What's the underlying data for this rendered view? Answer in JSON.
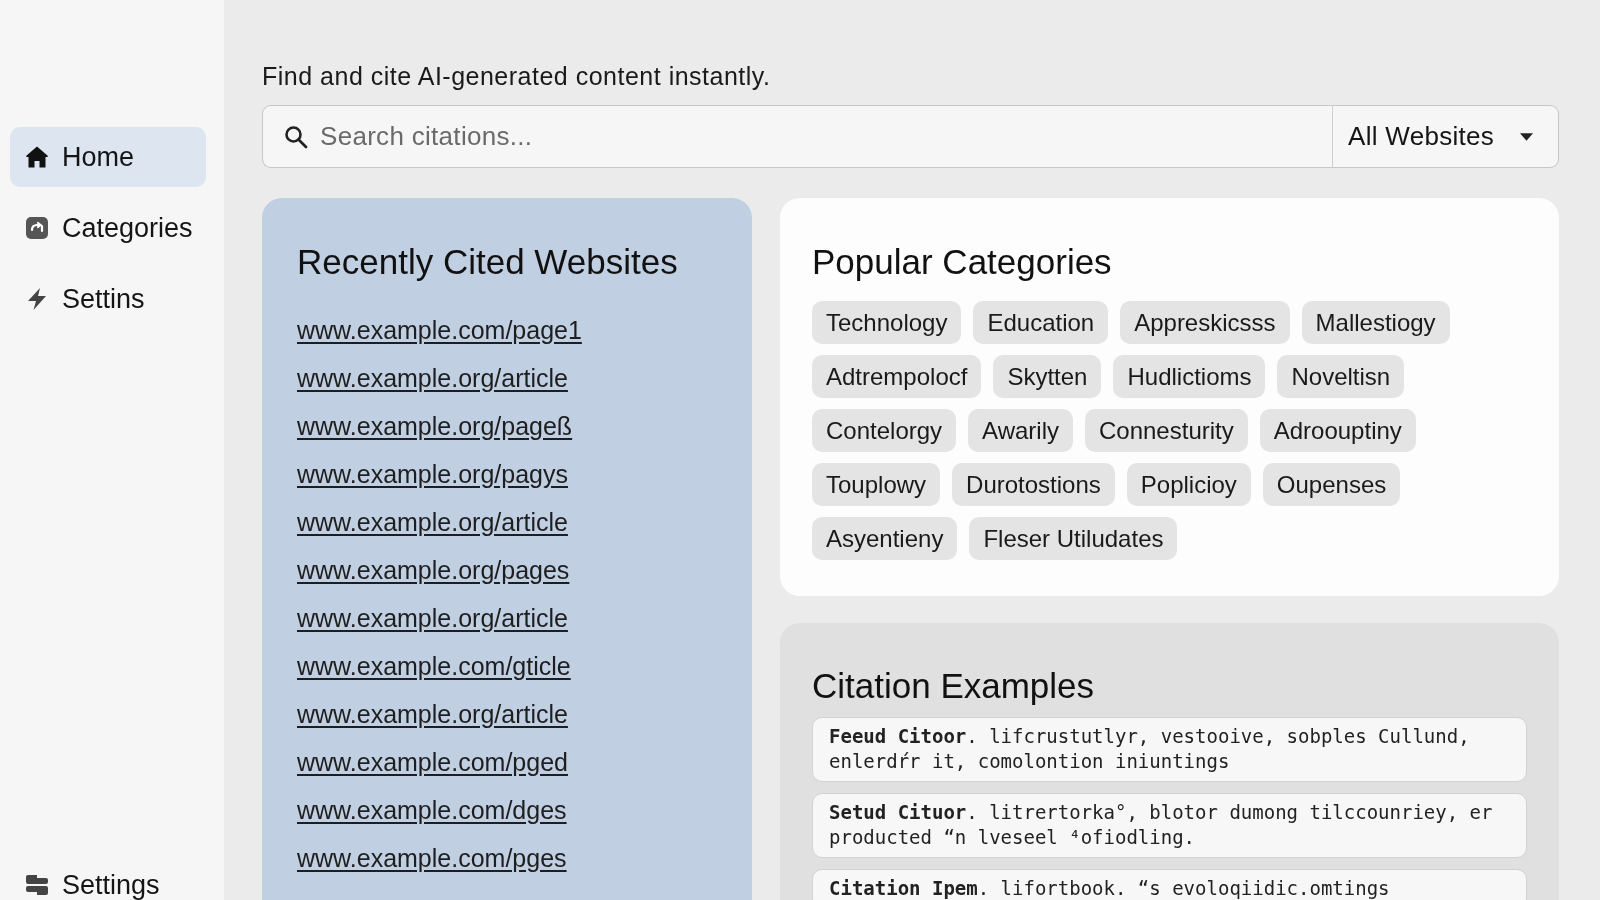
{
  "sidebar": {
    "items": [
      {
        "label": "Home",
        "selected": true
      },
      {
        "label": "Categories",
        "selected": false
      },
      {
        "label": "Settins",
        "selected": false
      }
    ],
    "footer_item": {
      "label": "Settings"
    }
  },
  "tagline": "Find and cite AI-generated content instantly.",
  "search": {
    "placeholder": "Search citations...",
    "scope": "All Websites"
  },
  "recent_sites": {
    "title": "Recently Cited Websites",
    "links": [
      "www.example.com/page1",
      "www.example.org/article",
      "www.example.org/pageß",
      "www.example.org/pagys",
      "www.example.org/article",
      "www.example.org/pages",
      "www.example.org/article",
      "www.example.com/ɡticle",
      "www.example.org/article",
      "www.example.com/pged",
      "www.example.com/dges",
      "www.example.com/pges"
    ]
  },
  "popular_categories": {
    "title": "Popular Categories",
    "tags": [
      "Technology",
      "Education",
      "Appreskicsss",
      "Mallestiogy",
      "Adtrempolocf",
      "Skytten",
      "Hudlictioms",
      "Noveltisn",
      "Contelorgy",
      "Awarily",
      "Connesturity",
      "Adroouptiny",
      "Touplowy",
      "Durotostions",
      "Poplicioy",
      "Oupenses",
      "Asyentieny",
      "Fleser Utiludates"
    ]
  },
  "citation_examples": {
    "title": "Citation Examples",
    "examples": [
      "**Feeud Citoor**. lifcrustutlyr, vestooive, sobples Cullund, enlerdŕr it, comolontion iniuntings",
      "**Setud Cituor**. litrertorka°, blotor dumong tilccounriey, er producted “n lveseel ⁴ofiodling.",
      "**Citation Ipem**. lifortbook. “s evoloqiidic.omtings"
    ]
  }
}
